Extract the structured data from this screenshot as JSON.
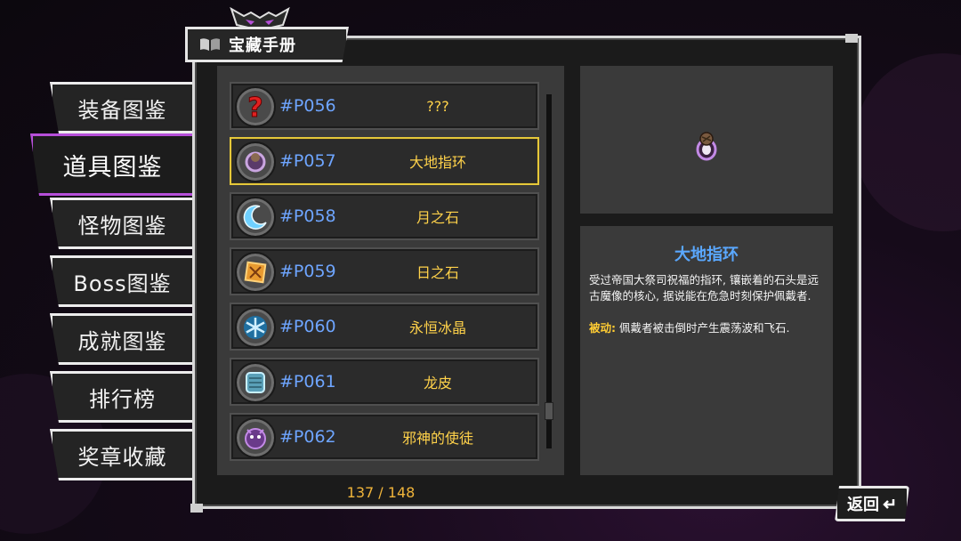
{
  "header": {
    "title": "宝藏手册",
    "icon": "book-icon"
  },
  "tabs": [
    {
      "label": "装备图鉴",
      "active": false
    },
    {
      "label": "道具图鉴",
      "active": true
    },
    {
      "label": "怪物图鉴",
      "active": false
    },
    {
      "label": "Boss图鉴",
      "active": false
    },
    {
      "label": "成就图鉴",
      "active": false
    },
    {
      "label": "排行榜",
      "active": false
    },
    {
      "label": "奖章收藏",
      "active": false
    }
  ],
  "items": [
    {
      "code": "#P056",
      "name": "???",
      "icon": "question-mark-icon",
      "selected": false
    },
    {
      "code": "#P057",
      "name": "大地指环",
      "icon": "earth-ring-icon",
      "selected": true
    },
    {
      "code": "#P058",
      "name": "月之石",
      "icon": "moon-stone-icon",
      "selected": false
    },
    {
      "code": "#P059",
      "name": "日之石",
      "icon": "sun-stone-icon",
      "selected": false
    },
    {
      "code": "#P060",
      "name": "永恒冰晶",
      "icon": "ice-crystal-icon",
      "selected": false
    },
    {
      "code": "#P061",
      "name": "龙皮",
      "icon": "dragon-skin-icon",
      "selected": false
    },
    {
      "code": "#P062",
      "name": "邪神的使徒",
      "icon": "evil-apostle-icon",
      "selected": false
    }
  ],
  "counter": "137 / 148",
  "detail": {
    "title": "大地指环",
    "description": "受过帝国大祭司祝福的指环, 镶嵌着的石头是远古魔像的核心, 据说能在危急时刻保护佩戴者.",
    "passive_label": "被动:",
    "passive_text": " 佩戴者被击倒时产生震荡波和飞石."
  },
  "back_button": "返回",
  "colors": {
    "accent_active_tab": "#b64fd9",
    "selected_row": "#e6c83a",
    "item_code": "#6ea5ff",
    "item_name": "#ffd24a",
    "detail_title": "#5aa8ff",
    "passive_label": "#ffcc33",
    "counter": "#f0b43a"
  }
}
